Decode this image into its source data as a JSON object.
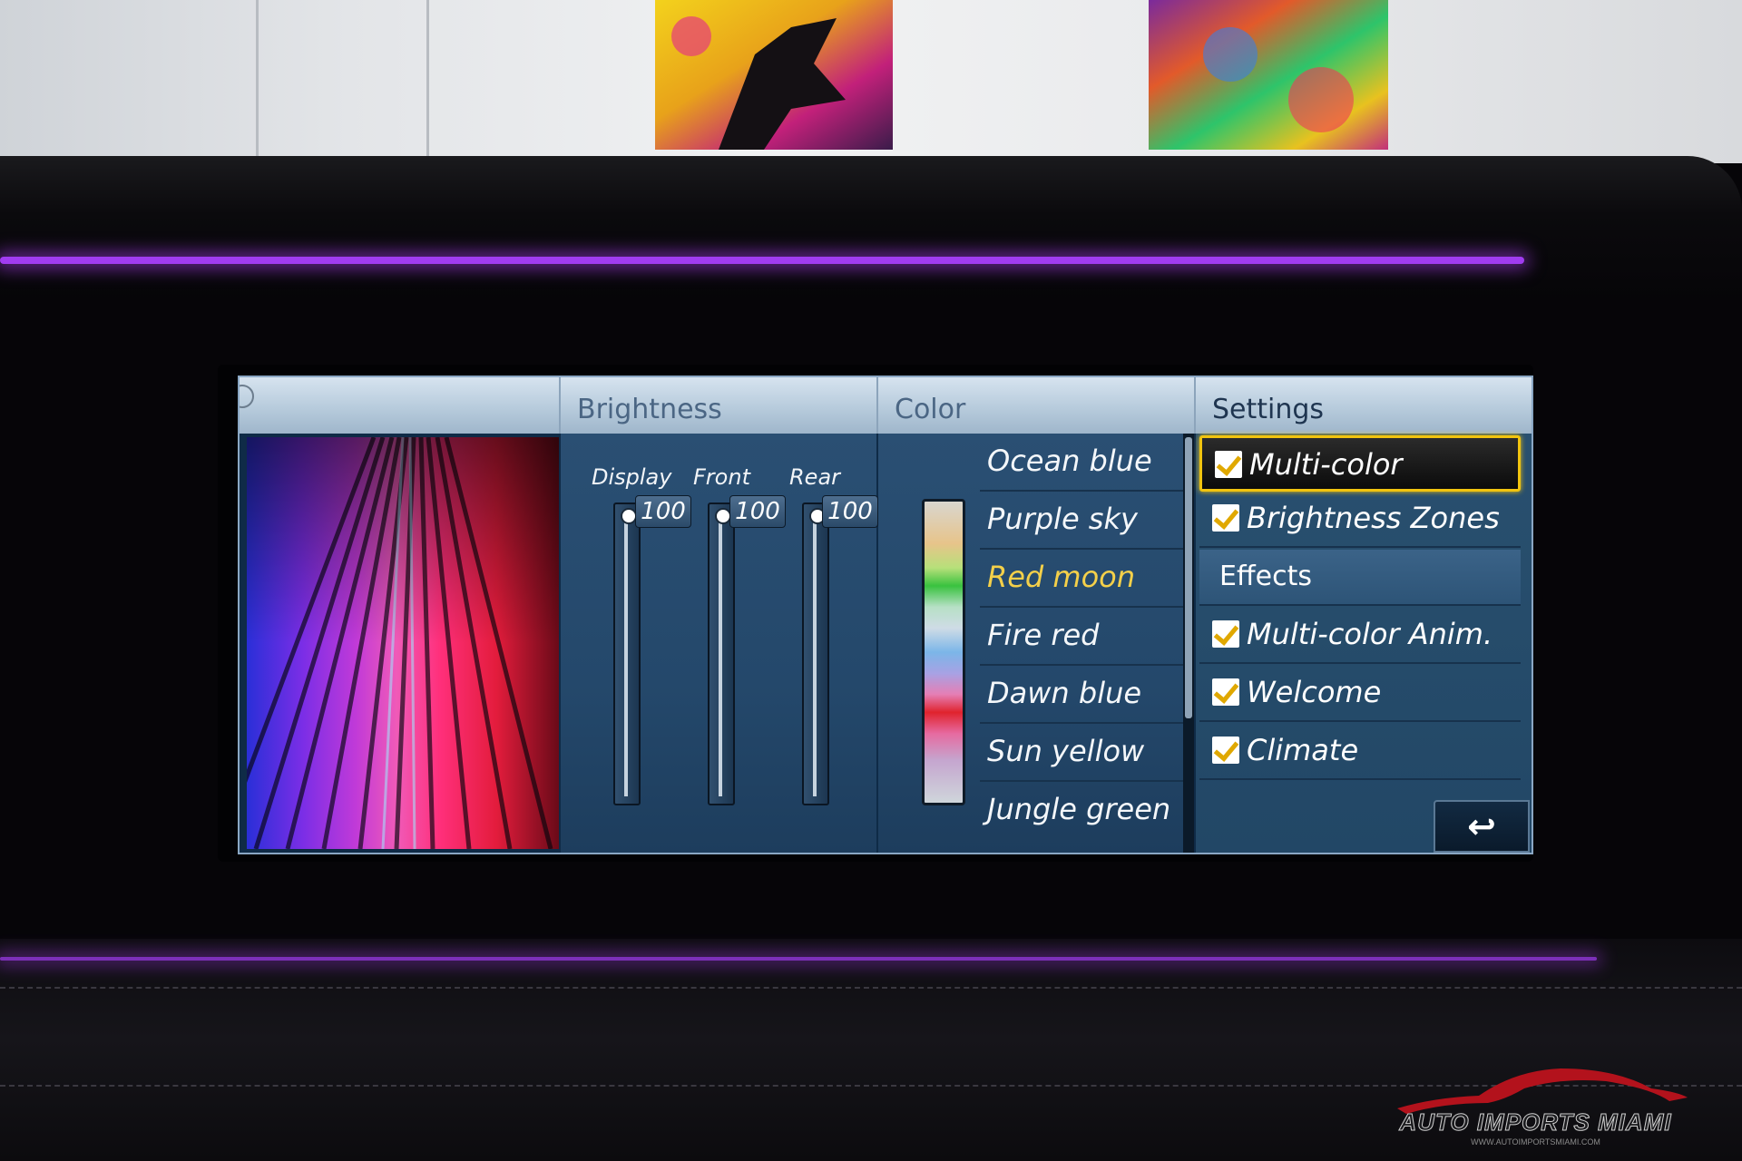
{
  "header": {
    "brightness_title": "Brightness",
    "color_title": "Color",
    "settings_title": "Settings"
  },
  "brightness": {
    "sliders": [
      {
        "label": "Display",
        "value": "100"
      },
      {
        "label": "Front",
        "value": "100"
      },
      {
        "label": "Rear",
        "value": "100"
      }
    ]
  },
  "color": {
    "items": [
      {
        "label": "Ocean blue"
      },
      {
        "label": "Purple sky"
      },
      {
        "label": "Red moon",
        "selected": true
      },
      {
        "label": "Fire red"
      },
      {
        "label": "Dawn blue"
      },
      {
        "label": "Sun yellow"
      },
      {
        "label": "Jungle green"
      }
    ]
  },
  "settings": {
    "multicolor": "Multi-color",
    "brightness_zones": "Brightness Zones",
    "effects_header": "Effects",
    "multicolor_anim": "Multi-color Anim.",
    "welcome": "Welcome",
    "climate": "Climate",
    "back_icon": "↩"
  },
  "watermark": {
    "brand": "AUTO IMPORTS MIAMI",
    "url": "WWW.AUTOIMPORTSMIAMI.COM"
  },
  "colors": {
    "accent_selected": "#f4d04a",
    "focus_border": "#f1c40f",
    "ambient": "#a13cf0"
  }
}
